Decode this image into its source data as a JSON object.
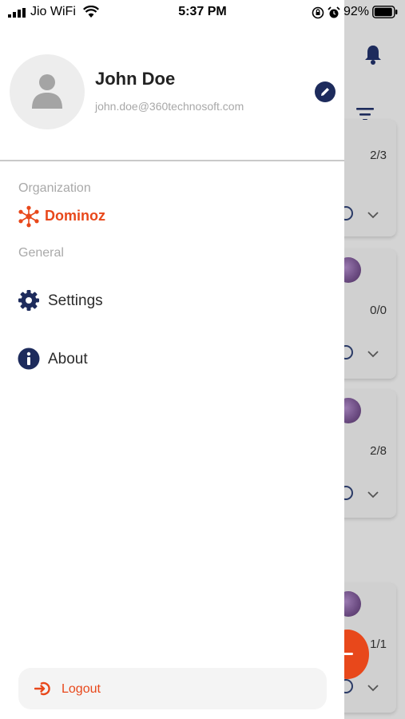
{
  "status_bar": {
    "carrier": "Jio WiFi",
    "time": "5:37 PM",
    "battery_percent": "92%"
  },
  "profile": {
    "name": "John Doe",
    "email": "john.doe@360technosoft.com"
  },
  "sections": {
    "organization_label": "Organization",
    "general_label": "General"
  },
  "organization": {
    "name": "Dominoz"
  },
  "menu": {
    "settings_label": "Settings",
    "about_label": "About"
  },
  "logout": {
    "label": "Logout"
  },
  "background_cards": {
    "counts": [
      "2/3",
      "0/0",
      "2/8",
      "1/1"
    ]
  },
  "colors": {
    "accent": "#e8481b",
    "navy": "#1d2b5c",
    "muted_text": "#a9a9a9"
  }
}
